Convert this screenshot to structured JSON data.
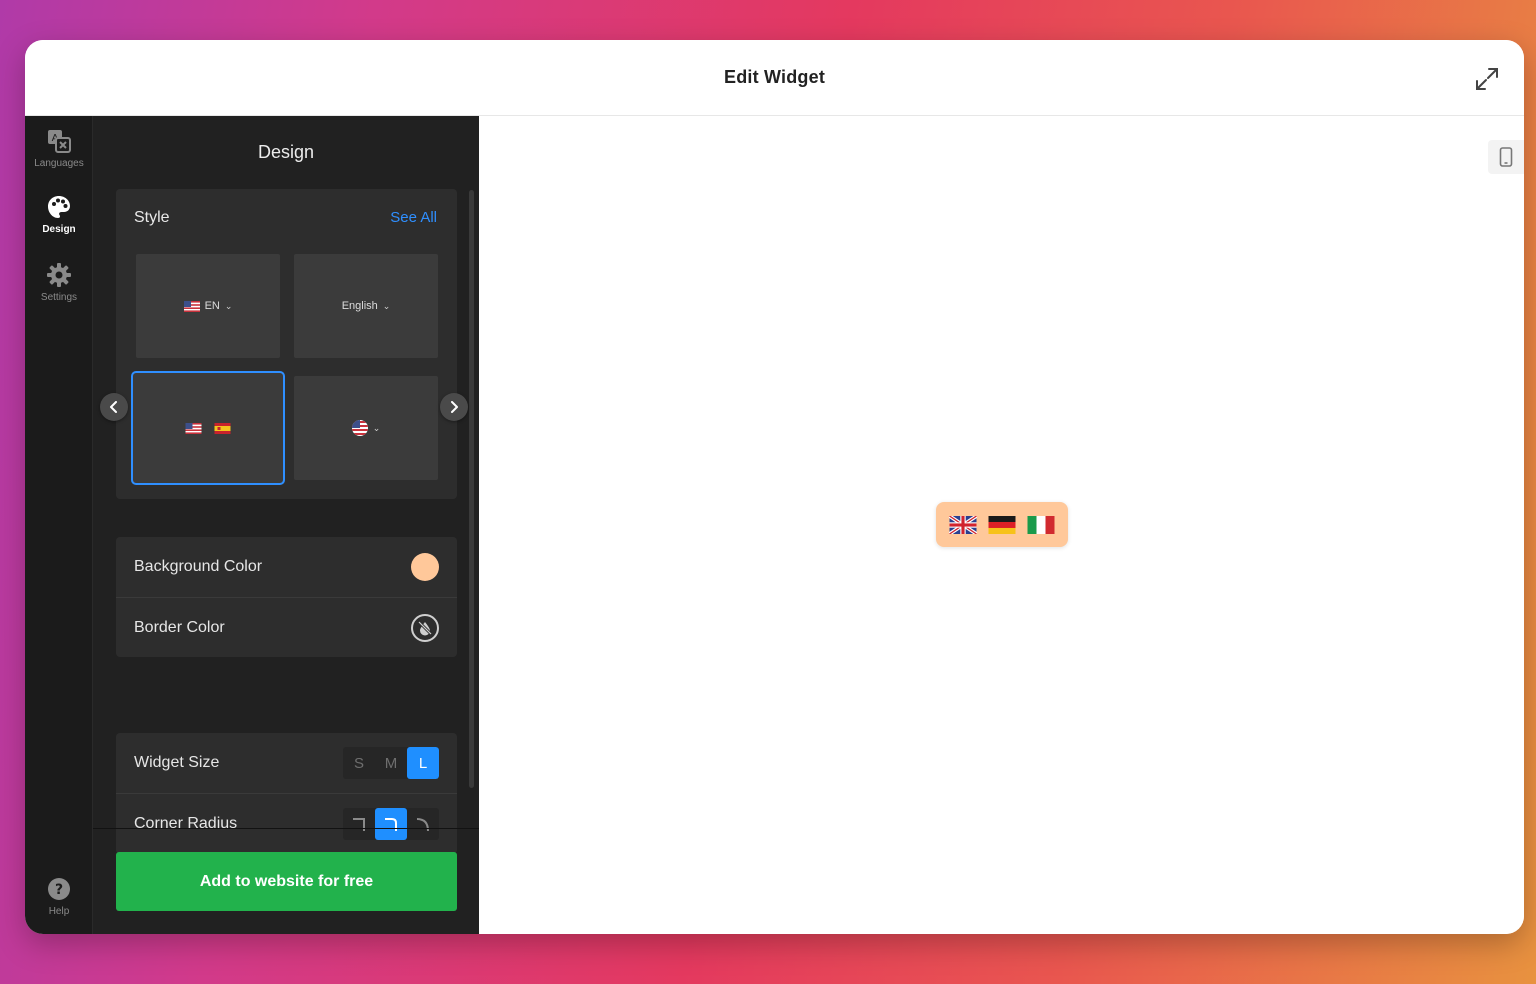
{
  "window": {
    "title": "Edit Widget"
  },
  "rail": {
    "items": [
      {
        "label": "Languages",
        "icon": "translate-icon"
      },
      {
        "label": "Design",
        "icon": "palette-icon"
      },
      {
        "label": "Settings",
        "icon": "gear-icon"
      }
    ],
    "help": {
      "label": "Help",
      "icon": "help-icon"
    }
  },
  "panel": {
    "title": "Design",
    "style": {
      "heading": "Style",
      "see_all": "See All",
      "tiles": [
        {
          "code": "EN"
        },
        {
          "name": "English"
        },
        {
          "selected": true
        },
        {
          "globe": true
        }
      ]
    },
    "colors": {
      "background_label": "Background Color",
      "background_value": "#ffc89a",
      "border_label": "Border Color"
    },
    "size": {
      "label": "Widget Size",
      "options": [
        "S",
        "M",
        "L"
      ],
      "selected": "L"
    },
    "radius": {
      "label": "Corner Radius",
      "selected_index": 1
    },
    "cta": "Add to website for free"
  },
  "preview": {
    "widget_bg": "#ffc89a",
    "flags": [
      "uk-flag",
      "germany-flag",
      "italy-flag"
    ]
  },
  "accent": "#1f8fff",
  "cta_color": "#22b24c"
}
